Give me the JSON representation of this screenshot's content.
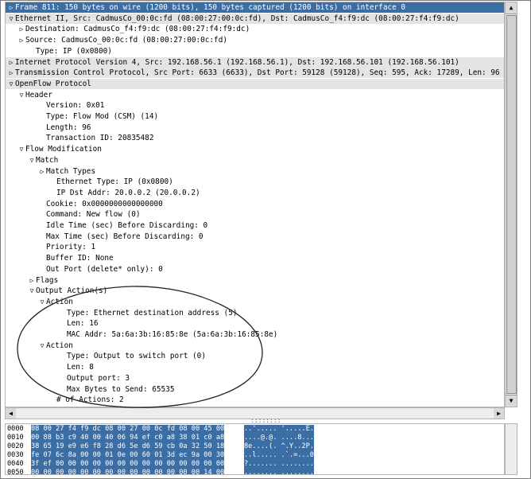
{
  "tree": [
    {
      "indent": 0,
      "tw": "expand",
      "text": "Frame 811: 150 bytes on wire (1200 bits), 150 bytes captured (1200 bits) on interface 0",
      "state": "selected"
    },
    {
      "indent": 0,
      "tw": "collapse",
      "text": "Ethernet II, Src: CadmusCo_00:0c:fd (08:00:27:00:0c:fd), Dst: CadmusCo_f4:f9:dc (08:00:27:f4:f9:dc)",
      "state": "alt"
    },
    {
      "indent": 1,
      "tw": "expand",
      "text": "Destination: CadmusCo_f4:f9:dc (08:00:27:f4:f9:dc)"
    },
    {
      "indent": 1,
      "tw": "expand",
      "text": "Source: CadmusCo_00:0c:fd (08:00:27:00:0c:fd)"
    },
    {
      "indent": 2,
      "tw": "",
      "text": "Type: IP (0x0800)"
    },
    {
      "indent": 0,
      "tw": "expand",
      "text": "Internet Protocol Version 4, Src: 192.168.56.1 (192.168.56.1), Dst: 192.168.56.101 (192.168.56.101)",
      "state": "alt"
    },
    {
      "indent": 0,
      "tw": "expand",
      "text": "Transmission Control Protocol, Src Port: 6633 (6633), Dst Port: 59128 (59128), Seq: 595, Ack: 17289, Len: 96",
      "state": "alt"
    },
    {
      "indent": 0,
      "tw": "collapse",
      "text": "OpenFlow Protocol",
      "state": "alt"
    },
    {
      "indent": 1,
      "tw": "collapse",
      "text": "Header"
    },
    {
      "indent": 3,
      "tw": "",
      "text": "Version: 0x01"
    },
    {
      "indent": 3,
      "tw": "",
      "text": "Type: Flow Mod (CSM) (14)"
    },
    {
      "indent": 3,
      "tw": "",
      "text": "Length: 96"
    },
    {
      "indent": 3,
      "tw": "",
      "text": "Transaction ID: 20835482"
    },
    {
      "indent": 1,
      "tw": "collapse",
      "text": "Flow Modification"
    },
    {
      "indent": 2,
      "tw": "collapse",
      "text": "Match"
    },
    {
      "indent": 3,
      "tw": "expand",
      "text": "Match Types"
    },
    {
      "indent": 4,
      "tw": "",
      "text": "Ethernet Type: IP (0x0800)"
    },
    {
      "indent": 4,
      "tw": "",
      "text": "IP Dst Addr: 20.0.0.2 (20.0.0.2)"
    },
    {
      "indent": 3,
      "tw": "",
      "text": "Cookie: 0x0000000000000000"
    },
    {
      "indent": 3,
      "tw": "",
      "text": "Command: New flow (0)"
    },
    {
      "indent": 3,
      "tw": "",
      "text": "Idle Time (sec) Before Discarding: 0"
    },
    {
      "indent": 3,
      "tw": "",
      "text": "Max Time (sec) Before Discarding: 0"
    },
    {
      "indent": 3,
      "tw": "",
      "text": "Priority: 1"
    },
    {
      "indent": 3,
      "tw": "",
      "text": "Buffer ID: None"
    },
    {
      "indent": 3,
      "tw": "",
      "text": "Out Port (delete* only): 0"
    },
    {
      "indent": 2,
      "tw": "expand",
      "text": "Flags"
    },
    {
      "indent": 2,
      "tw": "collapse",
      "text": "Output Action(s)"
    },
    {
      "indent": 3,
      "tw": "collapse",
      "text": "Action"
    },
    {
      "indent": 5,
      "tw": "",
      "text": "Type: Ethernet destination address (5)"
    },
    {
      "indent": 5,
      "tw": "",
      "text": "Len: 16"
    },
    {
      "indent": 5,
      "tw": "",
      "text": "MAC Addr: 5a:6a:3b:16:85:8e (5a:6a:3b:16:85:8e)"
    },
    {
      "indent": 3,
      "tw": "collapse",
      "text": "Action"
    },
    {
      "indent": 5,
      "tw": "",
      "text": "Type: Output to switch port (0)"
    },
    {
      "indent": 5,
      "tw": "",
      "text": "Len: 8"
    },
    {
      "indent": 5,
      "tw": "",
      "text": "Output port: 3"
    },
    {
      "indent": 5,
      "tw": "",
      "text": "Max Bytes to Send: 65535"
    },
    {
      "indent": 4,
      "tw": "",
      "text": "# of Actions: 2"
    }
  ],
  "hex": [
    {
      "off": "0000",
      "bytes": "08 00 27 f4 f9 dc 08 00  27 00 0c fd 08 00 45 00",
      "ascii": "..'.....  '.....E."
    },
    {
      "off": "0010",
      "bytes": "00 88 b3 c9 40 00 40 06  94 ef c0 a8 38 01 c0 a8",
      "ascii": "....@.@.  ....8..."
    },
    {
      "off": "0020",
      "bytes": "38 65 19 e9 e6 f8 28 d6  5e d6 59 cb 0a 32 50 18",
      "ascii": "8e....(.  ^.Y..2P."
    },
    {
      "off": "0030",
      "bytes": "fe 07 6c 8a 00 00 01 0e  00 60 01 3d ec 9a 00 30",
      "ascii": "..l.....  .`.=...0"
    },
    {
      "off": "0040",
      "bytes": "3f ef 00 00 00 00 00 00  00 00 00 00 00 00 00 00",
      "ascii": "?.......  ........"
    },
    {
      "off": "0050",
      "bytes": "00 00 00 00 00 00 00 00  00 00 00 00 00 00 14 00",
      "ascii": "........  ........"
    }
  ],
  "colors": {
    "selected": "#3a6ea5",
    "alt_row": "#e4e4e4"
  }
}
